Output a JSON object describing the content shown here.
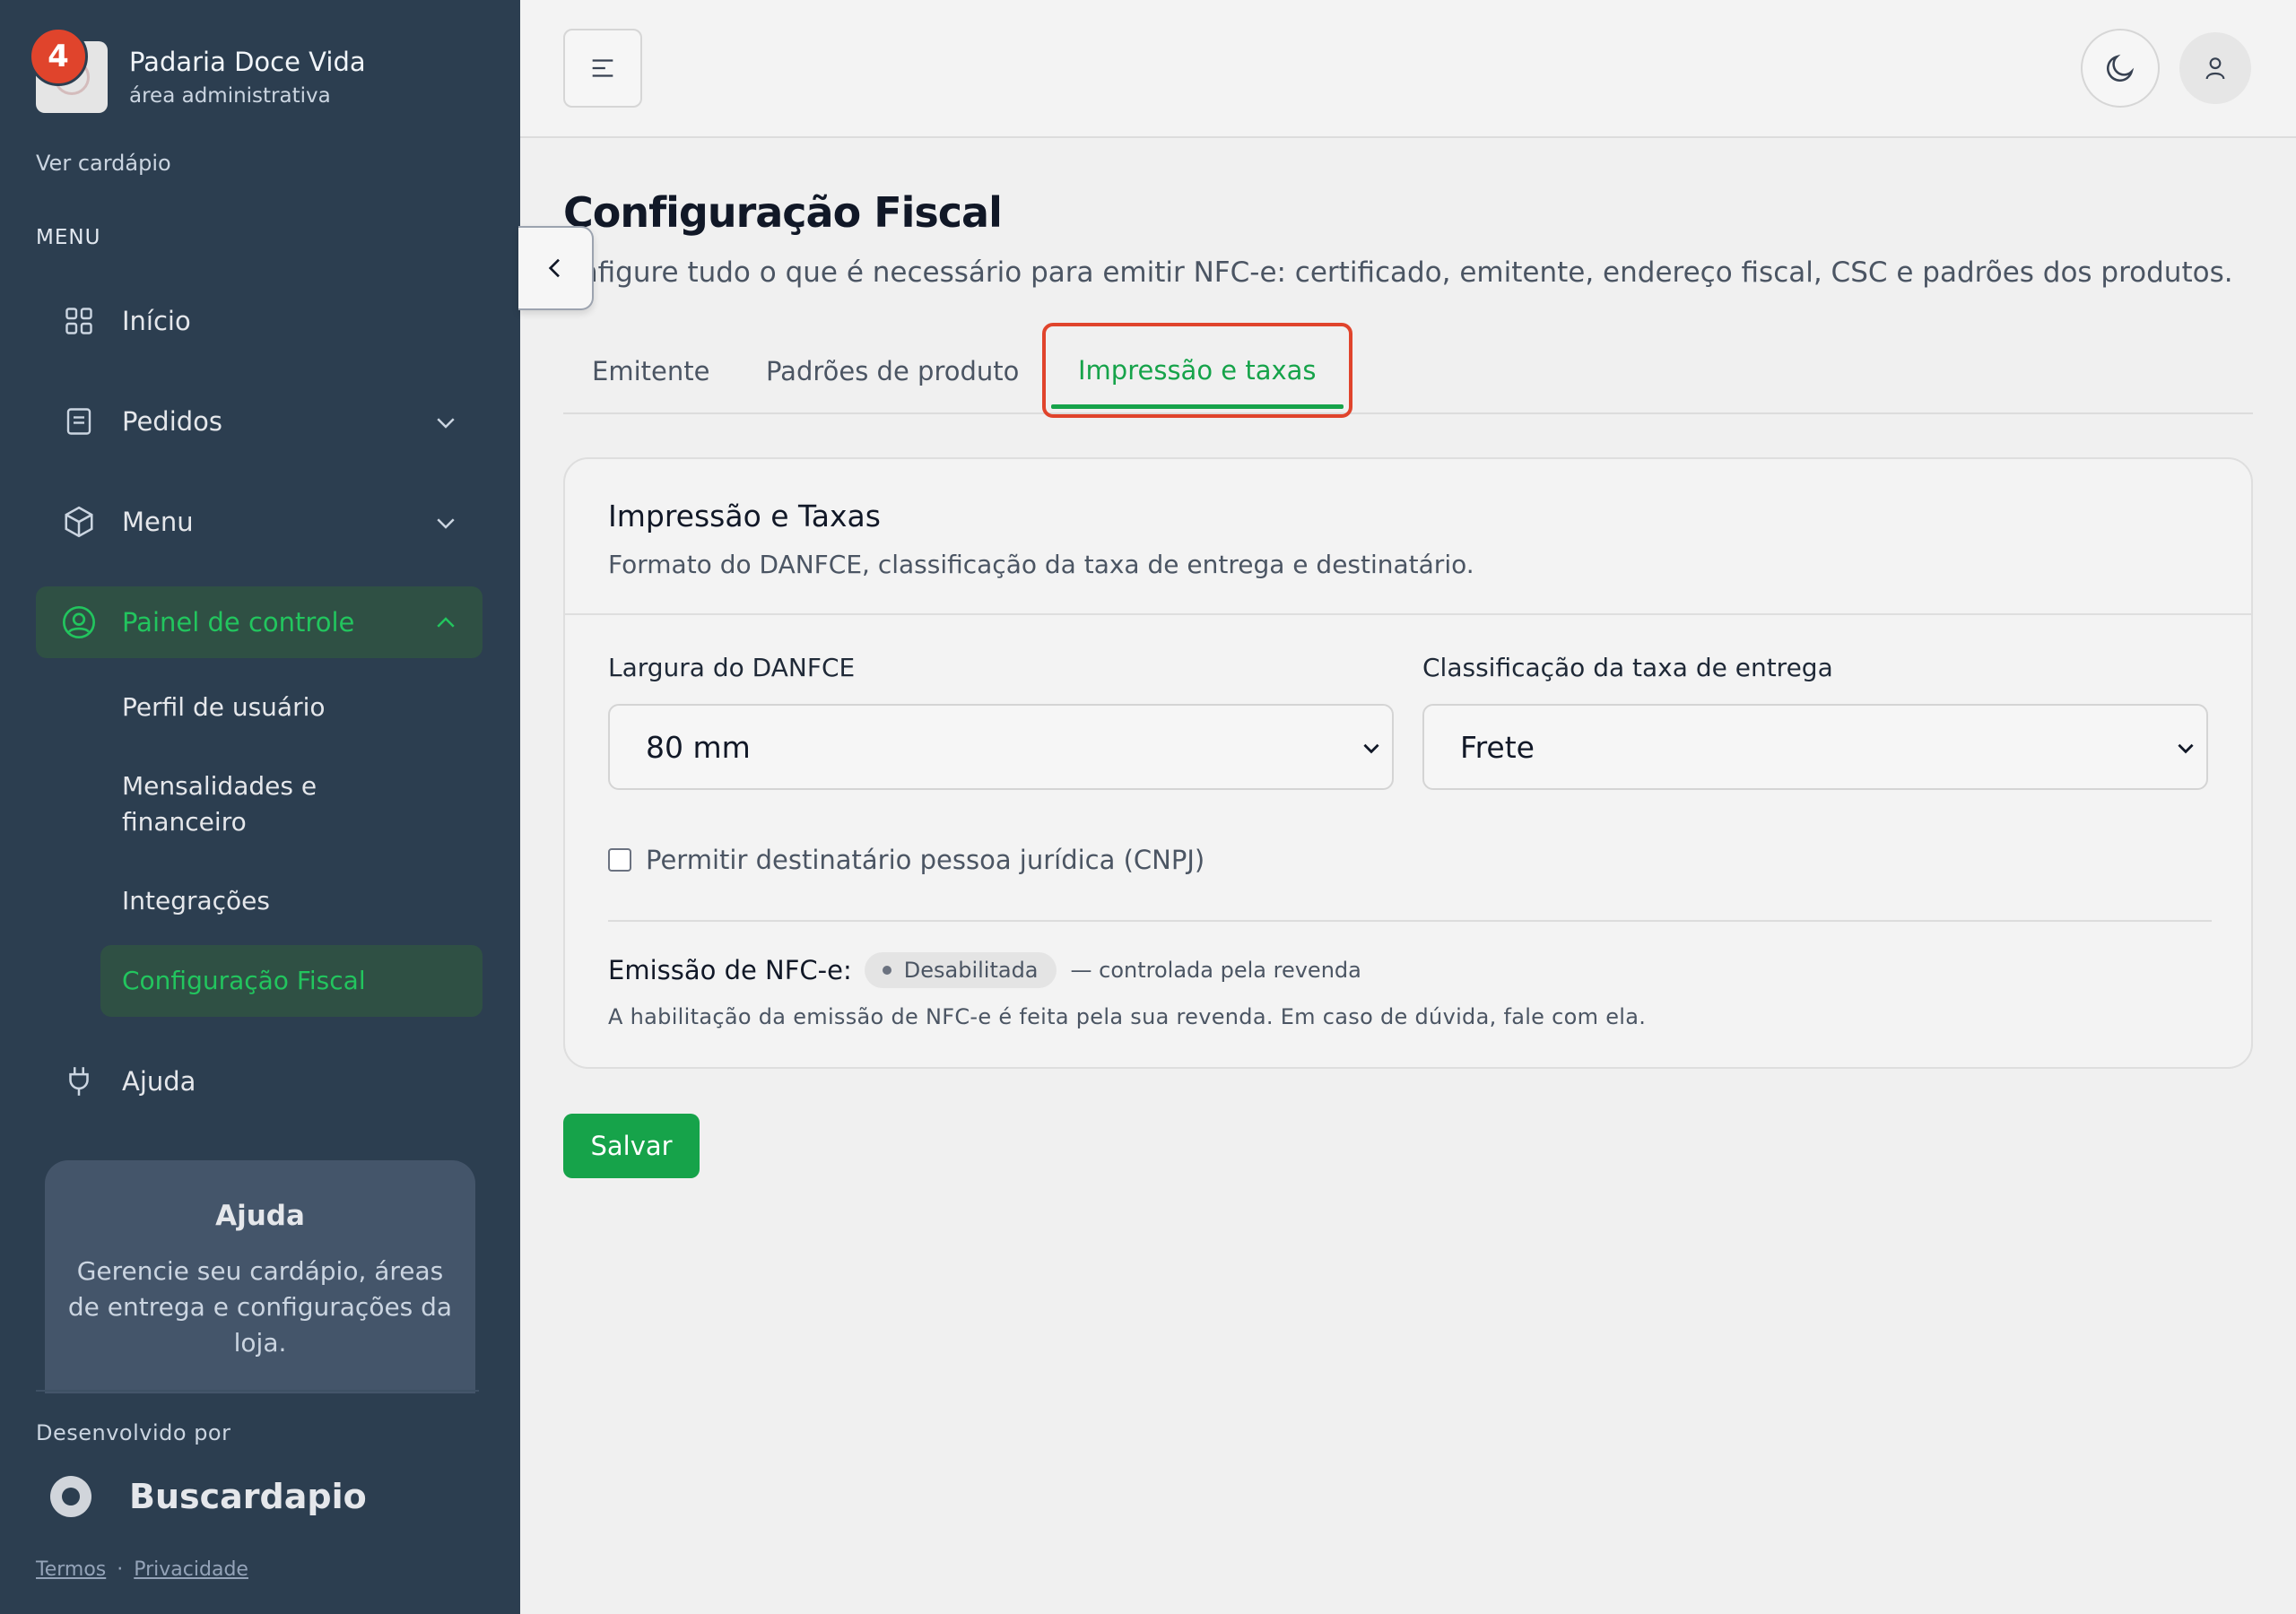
{
  "brand": {
    "name": "Padaria Doce Vida",
    "subtitle": "área administrativa",
    "notification_count": "4"
  },
  "sidebar": {
    "view_menu_link": "Ver cardápio",
    "menu_heading": "MENU",
    "items": [
      {
        "label": "Início",
        "icon": "grid-icon"
      },
      {
        "label": "Pedidos",
        "icon": "receipt-icon"
      },
      {
        "label": "Menu",
        "icon": "box-icon"
      },
      {
        "label": "Painel de controle",
        "icon": "user-circle-icon"
      },
      {
        "label": "Ajuda",
        "icon": "plug-icon"
      }
    ],
    "subitems": [
      {
        "label": "Perfil de usuário"
      },
      {
        "label": "Mensalidades e financeiro"
      },
      {
        "label": "Integrações"
      },
      {
        "label": "Configuração Fiscal"
      }
    ],
    "help_card": {
      "title": "Ajuda",
      "description": "Gerencie seu cardápio, áreas de entrega e configurações da loja."
    },
    "developed_by": "Desenvolvido por",
    "developer_name": "Buscardapio",
    "footer": {
      "terms": "Termos",
      "separator": "·",
      "privacy": "Privacidade"
    }
  },
  "page": {
    "title": "Configuração Fiscal",
    "description": "onfigure tudo o que é necessário para emitir NFC-e: certificado, emitente, endereço fiscal, CSC e padrões dos produtos.",
    "tabs": [
      {
        "label": "Emitente"
      },
      {
        "label": "Padrões de produto"
      },
      {
        "label": "Impressão e taxas"
      }
    ],
    "active_tab": "Impressão e taxas"
  },
  "card": {
    "title": "Impressão e Taxas",
    "subtitle": "Formato do DANFCE, classificação da taxa de entrega e destinatário.",
    "danfce_width": {
      "label": "Largura do DANFCE",
      "value": "80 mm"
    },
    "delivery_fee_class": {
      "label": "Classificação da taxa de entrega",
      "value": "Frete"
    },
    "allow_cnpj": {
      "label": "Permitir destinatário pessoa jurídica (CNPJ)",
      "checked": false
    },
    "nfce": {
      "label": "Emissão de NFC-e:",
      "status": "Desabilitada",
      "note": "— controlada pela revenda",
      "help": "A habilitação da emissão de NFC-e é feita pela sua revenda. Em caso de dúvida, fale com ela."
    }
  },
  "actions": {
    "save_label": "Salvar"
  },
  "colors": {
    "sidebar_bg": "#2c3e50",
    "accent_green": "#16a34a",
    "active_nav_bg": "#2f5044",
    "highlight_red": "#e0442c",
    "page_bg": "#f0f0f0"
  }
}
